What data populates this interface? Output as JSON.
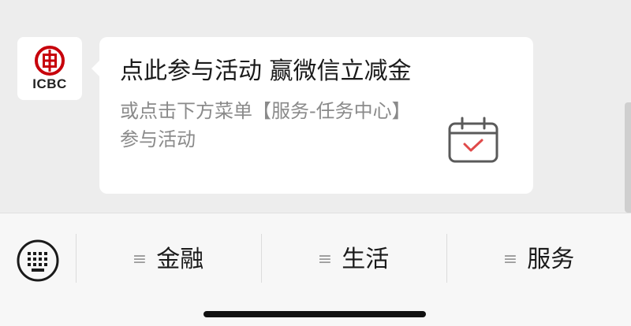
{
  "chat": {
    "sender": {
      "logo_text": "ICBC",
      "brand_color": "#c7000b"
    },
    "message": {
      "title": "点此参与活动 赢微信立减金",
      "description": "或点击下方菜单【服务-任务中心】参与活动",
      "icon": "calendar-check-icon",
      "accent_color": "#e04a4a"
    }
  },
  "menu": {
    "keyboard_icon": "keyboard-icon",
    "items": [
      {
        "label": "金融",
        "icon": "menu-lines-icon"
      },
      {
        "label": "生活",
        "icon": "menu-lines-icon"
      },
      {
        "label": "服务",
        "icon": "menu-lines-icon"
      }
    ]
  }
}
